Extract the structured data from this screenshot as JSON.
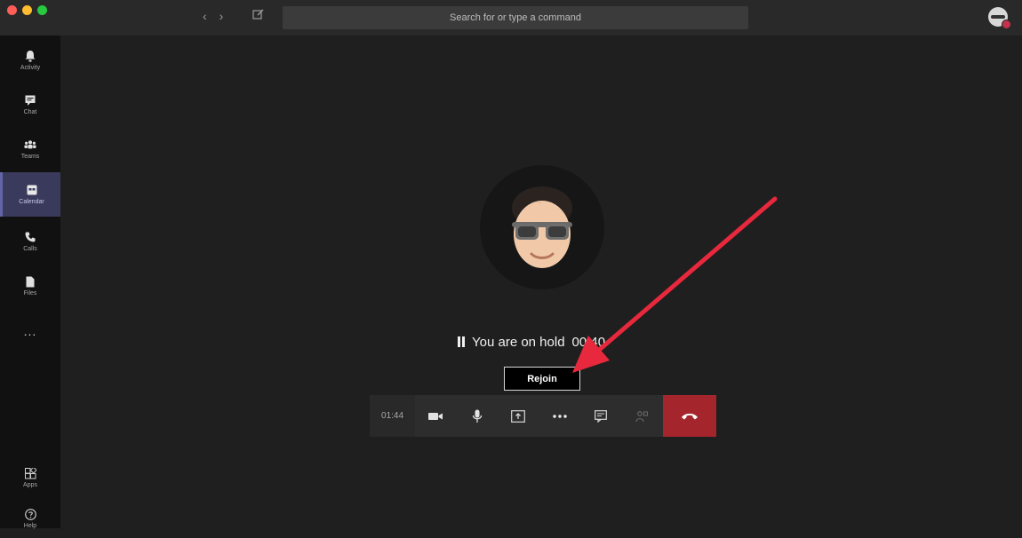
{
  "titlebar": {
    "search_placeholder": "Search for or type a command",
    "traffic_colors": [
      "#ff5f57",
      "#febc2e",
      "#28c840"
    ]
  },
  "rail": {
    "items": [
      {
        "label": "Activity",
        "icon": "bell-icon"
      },
      {
        "label": "Chat",
        "icon": "chat-icon"
      },
      {
        "label": "Teams",
        "icon": "teams-icon"
      },
      {
        "label": "Calendar",
        "icon": "calendar-icon",
        "active": true
      },
      {
        "label": "Calls",
        "icon": "phone-icon"
      },
      {
        "label": "Files",
        "icon": "file-icon"
      }
    ],
    "more": "...",
    "bottom": [
      {
        "label": "Apps",
        "icon": "apps-icon"
      },
      {
        "label": "Help",
        "icon": "help-icon"
      }
    ]
  },
  "call": {
    "hold_text": "You are on hold",
    "hold_timer": "00:40",
    "rejoin_label": "Rejoin",
    "duration": "01:44"
  },
  "colors": {
    "accent": "#6264a7",
    "hangup": "#a4262c",
    "arrow": "#e8283c"
  }
}
